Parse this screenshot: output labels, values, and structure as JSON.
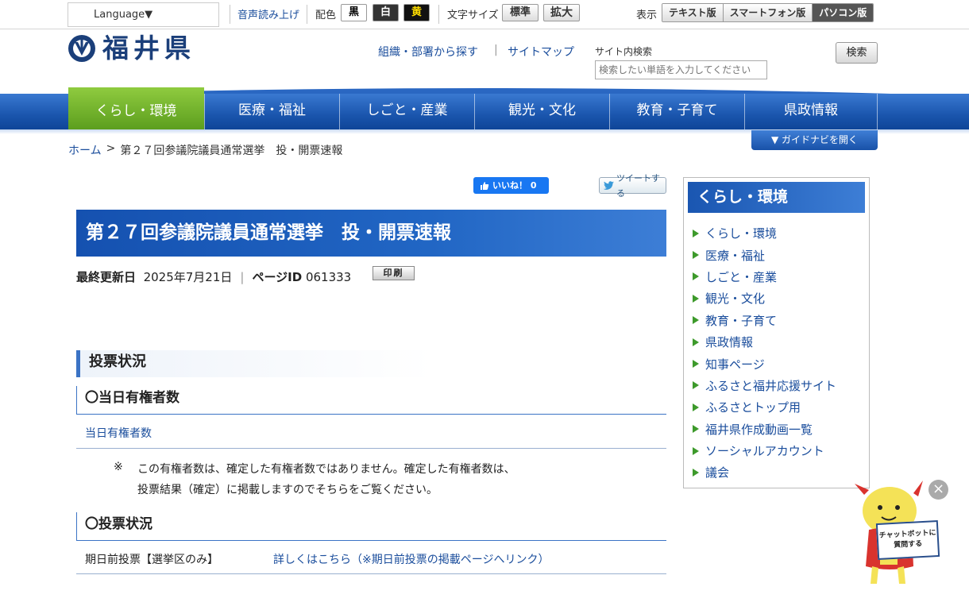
{
  "utility": {
    "language": "Language▼",
    "voice": "音声読み上げ",
    "color_label": "配色",
    "color_black": "黒",
    "color_white": "白",
    "color_yellow": "黄",
    "font_label": "文字サイズ",
    "font_standard": "標準",
    "font_large": "拡大",
    "view_label": "表示",
    "view_text": "テキスト版",
    "view_smartphone": "スマートフォン版",
    "view_pc": "パソコン版"
  },
  "header": {
    "logo_text": "福井県",
    "link_org": "組織・部署から探す",
    "link_sitemap": "サイトマップ",
    "search_label": "サイト内検索",
    "search_placeholder": "検索したい単語を入力してください",
    "search_button": "検索"
  },
  "nav": {
    "items": [
      {
        "label": "くらし・環境"
      },
      {
        "label": "医療・福祉"
      },
      {
        "label": "しごと・産業"
      },
      {
        "label": "観光・文化"
      },
      {
        "label": "教育・子育て"
      },
      {
        "label": "県政情報"
      }
    ],
    "guide": "▼ ガイドナビを開く"
  },
  "breadcrumb": {
    "home": "ホーム",
    "sep": ">",
    "current": "第２７回参議院議員通常選挙　投・開票速報"
  },
  "share": {
    "like": "いいね！ 0",
    "tweet": "ツイートする"
  },
  "main": {
    "title": "第２７回参議院議員通常選挙　投・開票速報",
    "updated_label": "最終更新日",
    "updated_date": "2025年7月21日",
    "pageid_label": "ページID",
    "pageid": "061333",
    "print": "印刷",
    "h2_voting": "投票状況",
    "h3_voters": "〇当日有権者数",
    "voters_link": "当日有権者数",
    "note_mark": "※",
    "note_line1": "この有権者数は、確定した有権者数ではありません。確定した有権者数は、",
    "note_line2": "投票結果（確定）に掲載しますのでそちらをご覧ください。",
    "h3_status": "〇投票状況",
    "early_label": "期日前投票【選挙区のみ】",
    "early_link": "詳しくはこちら（※期日前投票の掲載ページへリンク）"
  },
  "sidebar": {
    "title": "くらし・環境",
    "items": [
      "くらし・環境",
      "医療・福祉",
      "しごと・産業",
      "観光・文化",
      "教育・子育て",
      "県政情報",
      "知事ページ",
      "ふるさと福井応援サイト",
      "ふるさとトップ用",
      "福井県作成動画一覧",
      "ソーシャルアカウント",
      "議会"
    ]
  },
  "chatbot": {
    "close": "×",
    "sign_line1": "チャットボットに",
    "sign_line2": "質問する"
  }
}
